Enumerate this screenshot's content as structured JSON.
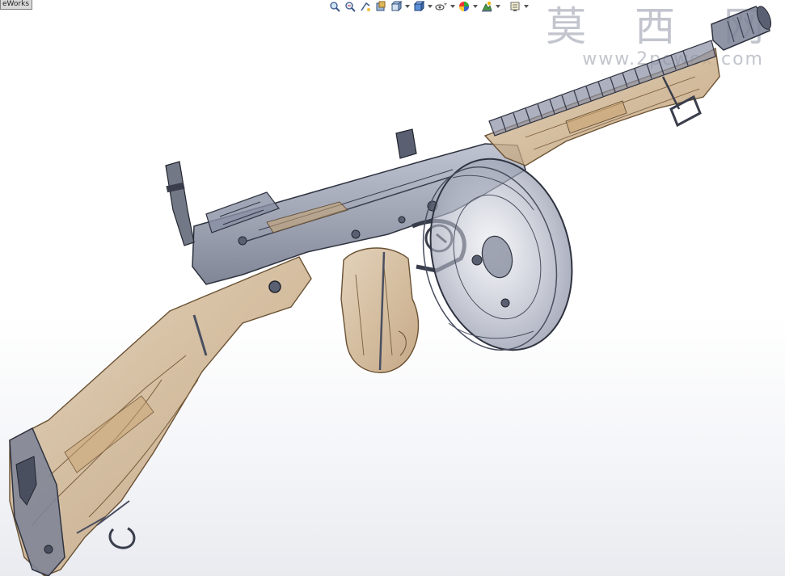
{
  "app": {
    "tab_label": "eWorks"
  },
  "toolbar": {
    "items": [
      {
        "name": "zoom-to-fit-icon",
        "has_dropdown": false
      },
      {
        "name": "zoom-to-area-icon",
        "has_dropdown": false
      },
      {
        "name": "previous-view-icon",
        "has_dropdown": false
      },
      {
        "name": "section-view-icon",
        "has_dropdown": false
      },
      {
        "name": "view-orientation-icon",
        "has_dropdown": true
      },
      {
        "name": "display-style-icon",
        "has_dropdown": true
      },
      {
        "name": "hide-show-items-icon",
        "has_dropdown": true
      },
      {
        "name": "edit-appearance-icon",
        "has_dropdown": true
      },
      {
        "name": "apply-scene-icon",
        "has_dropdown": true
      },
      {
        "name": "view-settings-icon",
        "has_dropdown": true
      }
    ]
  },
  "watermark": {
    "title": "莫 西 网",
    "url": "www.2pcwox.com"
  },
  "colors": {
    "metal": "#7d8396",
    "wood": "#c8ab86",
    "background": "#ffffff"
  }
}
